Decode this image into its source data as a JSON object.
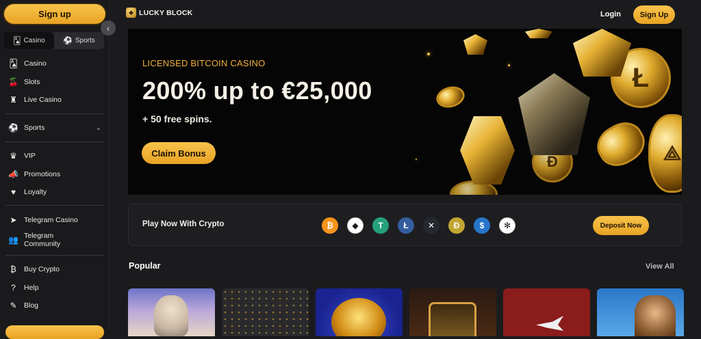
{
  "sidebar": {
    "signup_label": "Sign up",
    "tabs": [
      {
        "label": "Casino",
        "icon": "cards-icon"
      },
      {
        "label": "Sports",
        "icon": "ball-icon"
      }
    ],
    "casino_items": [
      {
        "label": "Casino",
        "icon": "cards-icon"
      },
      {
        "label": "Slots",
        "icon": "cherry-icon"
      },
      {
        "label": "Live Casino",
        "icon": "dealer-icon"
      }
    ],
    "sports_item": {
      "label": "Sports",
      "icon": "ball-icon"
    },
    "promo_items": [
      {
        "label": "VIP",
        "icon": "crown-icon"
      },
      {
        "label": "Promotions",
        "icon": "megaphone-icon"
      },
      {
        "label": "Loyalty",
        "icon": "heart-hand-icon"
      }
    ],
    "community_items": [
      {
        "label": "Telegram Casino",
        "icon": "telegram-icon"
      },
      {
        "label": "Telegram Community",
        "icon": "people-icon"
      }
    ],
    "help_items": [
      {
        "label": "Buy Crypto",
        "icon": "bitcoin-icon"
      },
      {
        "label": "Help",
        "icon": "help-icon"
      },
      {
        "label": "Blog",
        "icon": "blog-icon"
      }
    ]
  },
  "header": {
    "brand": "LUCKY BLOCK",
    "login_label": "Login",
    "signup_label": "Sign Up"
  },
  "hero": {
    "kicker": "LICENSED BITCOIN CASINO",
    "title": "200% up to €25,000",
    "subtitle": "+ 50 free spins.",
    "cta_label": "Claim Bonus"
  },
  "crypto": {
    "label": "Play Now With Crypto",
    "coins": [
      {
        "name": "bitcoin-icon",
        "glyph": "₿",
        "color": "#f7931a"
      },
      {
        "name": "ethereum-icon",
        "glyph": "◆",
        "color": "#ffffff"
      },
      {
        "name": "tether-icon",
        "glyph": "T",
        "color": "#26a17b"
      },
      {
        "name": "litecoin-icon",
        "glyph": "Ł",
        "color": "#345d9d"
      },
      {
        "name": "xrp-icon",
        "glyph": "✕",
        "color": "#23292f"
      },
      {
        "name": "dogecoin-icon",
        "glyph": "Ð",
        "color": "#c2a633"
      },
      {
        "name": "usdc-icon",
        "glyph": "$",
        "color": "#2775ca"
      },
      {
        "name": "cardano-icon",
        "glyph": "✻",
        "color": "#ffffff"
      }
    ],
    "deposit_label": "Deposit Now"
  },
  "popular": {
    "title": "Popular",
    "view_all_label": "View All",
    "games": [
      {
        "name": "game-tile-zeus"
      },
      {
        "name": "game-tile-dark-pattern"
      },
      {
        "name": "game-tile-golden-lion"
      },
      {
        "name": "game-tile-temple"
      },
      {
        "name": "game-tile-red-plane"
      },
      {
        "name": "game-tile-cowboy"
      }
    ]
  }
}
